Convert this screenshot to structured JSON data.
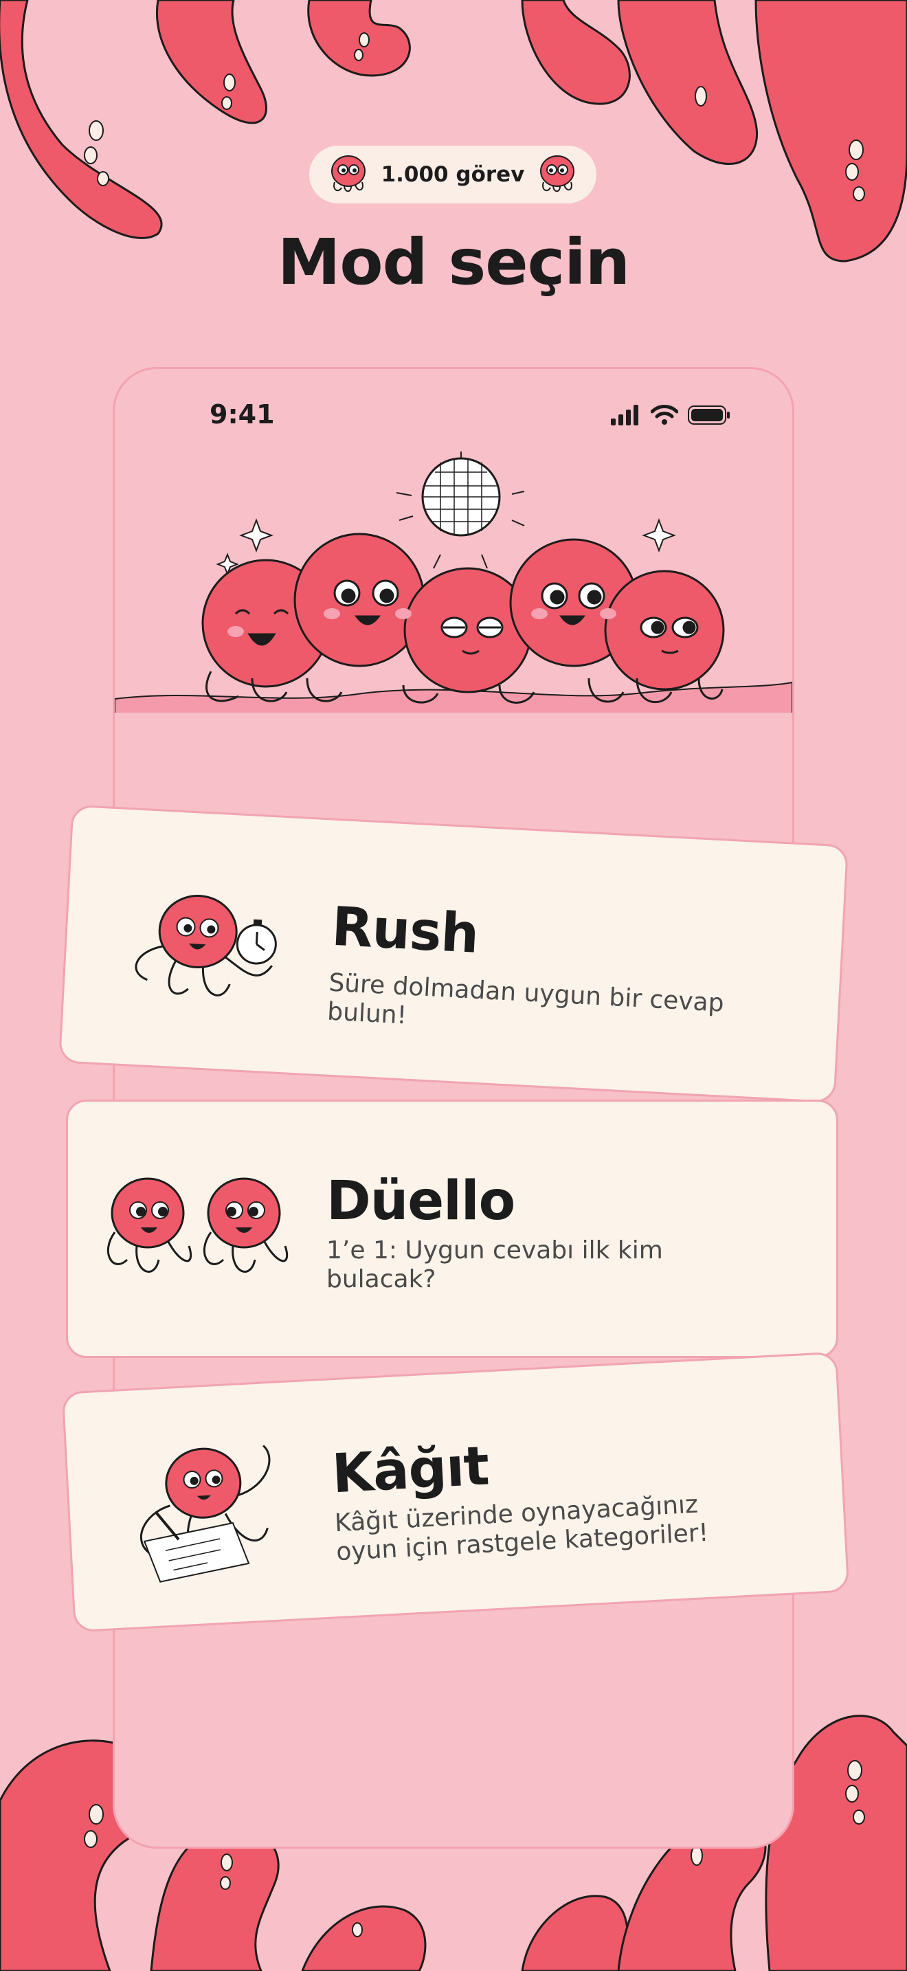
{
  "badge": {
    "text": "1.000 görev"
  },
  "title": "Mod seçin",
  "status": {
    "time": "9:41"
  },
  "modes": [
    {
      "name": "Rush",
      "description": "Süre dolmadan uygun bir cevap bulun!"
    },
    {
      "name": "Düello",
      "description": "1’e 1: Uygun cevabı ilk kim bulacak?"
    },
    {
      "name": "Kâğıt",
      "description": "Kâğıt üzerinde oynayacağınız oyun için rastgele kategoriler!"
    }
  ],
  "colors": {
    "background": "#f8c0c8",
    "octopus": "#ee5a6a",
    "card": "#fcf3ea",
    "card_border": "#f1a4b2",
    "text": "#1c1c1c"
  }
}
